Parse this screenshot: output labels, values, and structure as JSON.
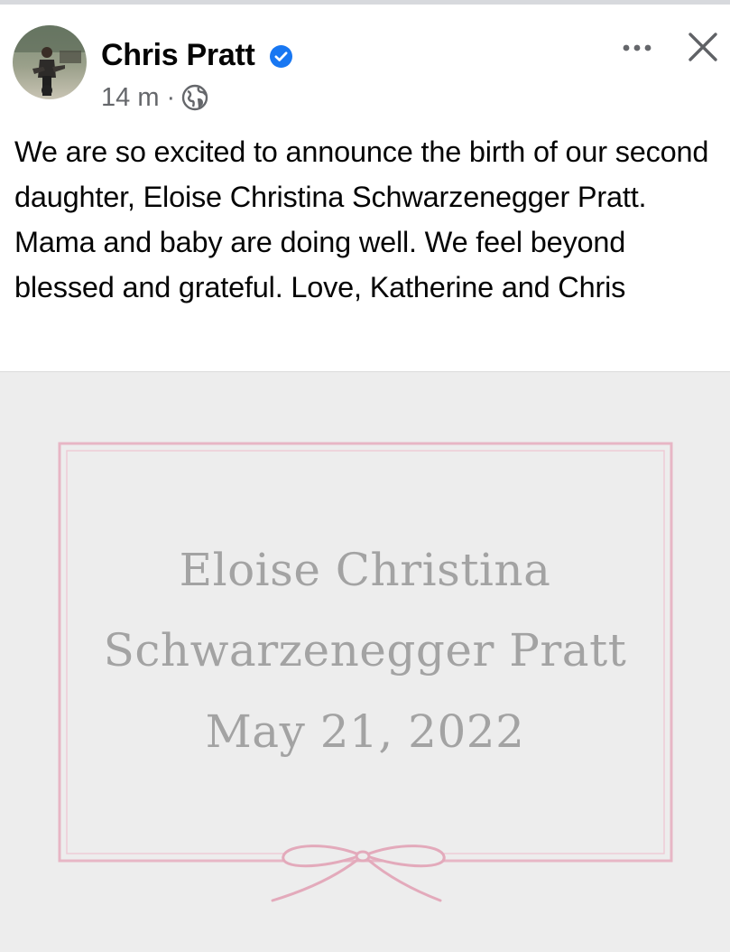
{
  "post": {
    "author": "Chris Pratt",
    "verified": true,
    "timestamp": "14 m",
    "separator": "·",
    "audience_icon": "globe-icon",
    "text": "We are so excited to announce the birth of our second daughter, Eloise Christina Schwarzenegger Pratt. Mama and baby are doing well. We feel beyond blessed and grateful. Love, Katherine and Chris",
    "header_icons": {
      "more": "more-horizontal-icon",
      "close": "close-icon"
    }
  },
  "photo": {
    "line1": "Eloise Christina",
    "line2": "Schwarzenegger Pratt",
    "line3": "May 21, 2022",
    "decoration": "bow-icon"
  },
  "colors": {
    "verified_blue": "#1877f2",
    "secondary_text": "#65676b",
    "card_text": "#a3a3a3",
    "card_frame_pink": "#e7b6c5",
    "photo_background": "#ededed"
  }
}
